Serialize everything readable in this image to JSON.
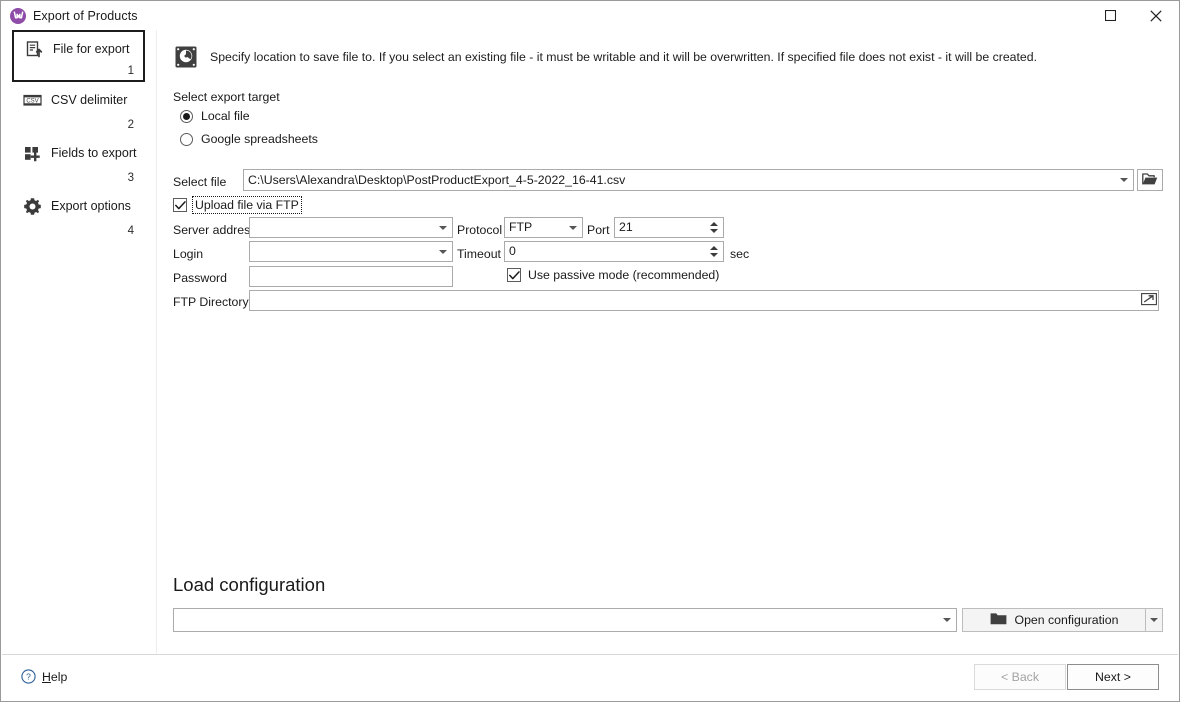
{
  "window": {
    "title": "Export of Products",
    "app_icon": "store-icon",
    "maximize_label": "Maximize",
    "close_label": "Close"
  },
  "sidebar": {
    "items": [
      {
        "label": "File for export",
        "number": "1",
        "icon": "file-export-icon",
        "active": true
      },
      {
        "label": "CSV delimiter",
        "number": "2",
        "icon": "csv-icon",
        "active": false
      },
      {
        "label": "Fields to export",
        "number": "3",
        "icon": "fields-add-icon",
        "active": false
      },
      {
        "label": "Export options",
        "number": "4",
        "icon": "gear-icon",
        "active": false
      }
    ]
  },
  "main": {
    "hint_icon": "hard-disk-icon",
    "hint": "Specify location to save file to. If you select an existing file - it must be writable and it will be overwritten. If specified file does not exist - it will be created.",
    "export_target": {
      "legend": "Select export target",
      "options": [
        {
          "label": "Local file",
          "selected": true
        },
        {
          "label": "Google spreadsheets",
          "selected": false
        }
      ]
    },
    "select_file": {
      "label": "Select file",
      "value": "C:\\Users\\Alexandra\\Desktop\\PostProductExport_4-5-2022_16-41.csv",
      "browse_icon": "open-folder-icon"
    },
    "upload_ftp": {
      "label": "Upload file via FTP",
      "checked": true
    },
    "ftp": {
      "server_address": {
        "label": "Server address",
        "value": ""
      },
      "login": {
        "label": "Login",
        "value": ""
      },
      "password": {
        "label": "Password",
        "value": ""
      },
      "ftp_directory": {
        "label": "FTP Directory",
        "value": "",
        "browse_icon": "open-folder-small-icon"
      },
      "protocol": {
        "label": "Protocol",
        "value": "FTP"
      },
      "port": {
        "label": "Port",
        "value": "21"
      },
      "timeout": {
        "label": "Timeout",
        "value": "0",
        "unit": "sec"
      },
      "passive_mode": {
        "label": "Use passive mode (recommended)",
        "checked": true
      }
    },
    "load_configuration": {
      "title": "Load configuration",
      "combo_value": "",
      "open_button_label": "Open configuration",
      "open_button_icon": "folder-icon"
    }
  },
  "footer": {
    "help": {
      "label": "Help",
      "icon": "help-circle-icon"
    },
    "back": {
      "label": "< Back",
      "disabled": true
    },
    "next": {
      "label": "Next >",
      "disabled": false
    }
  }
}
